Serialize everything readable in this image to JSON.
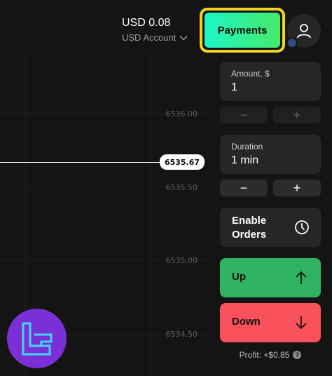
{
  "header": {
    "balance": "USD 0.08",
    "account_label": "USD Account",
    "payments_label": "Payments"
  },
  "chart": {
    "current_price": "6535.67",
    "ticks": [
      "6536.00",
      "6535.50",
      "6535.00",
      "6534.50"
    ]
  },
  "amount": {
    "label": "Amount, $",
    "value": "1",
    "minus": "−",
    "plus": "+"
  },
  "duration": {
    "label": "Duration",
    "value": "1 min",
    "minus": "−",
    "plus": "+"
  },
  "orders": {
    "label": "Enable Orders",
    "icon": "clock-icon"
  },
  "trade": {
    "up_label": "Up",
    "down_label": "Down",
    "up_color": "#2fb361",
    "down_color": "#f9515c"
  },
  "profit": {
    "label": "Profit: +$0.85",
    "help": "?"
  },
  "colors": {
    "payments_gradient": [
      "#1ef6c4",
      "#45e86a"
    ],
    "highlight": "#f5d320",
    "logo_bg": "#7b2fd6"
  }
}
